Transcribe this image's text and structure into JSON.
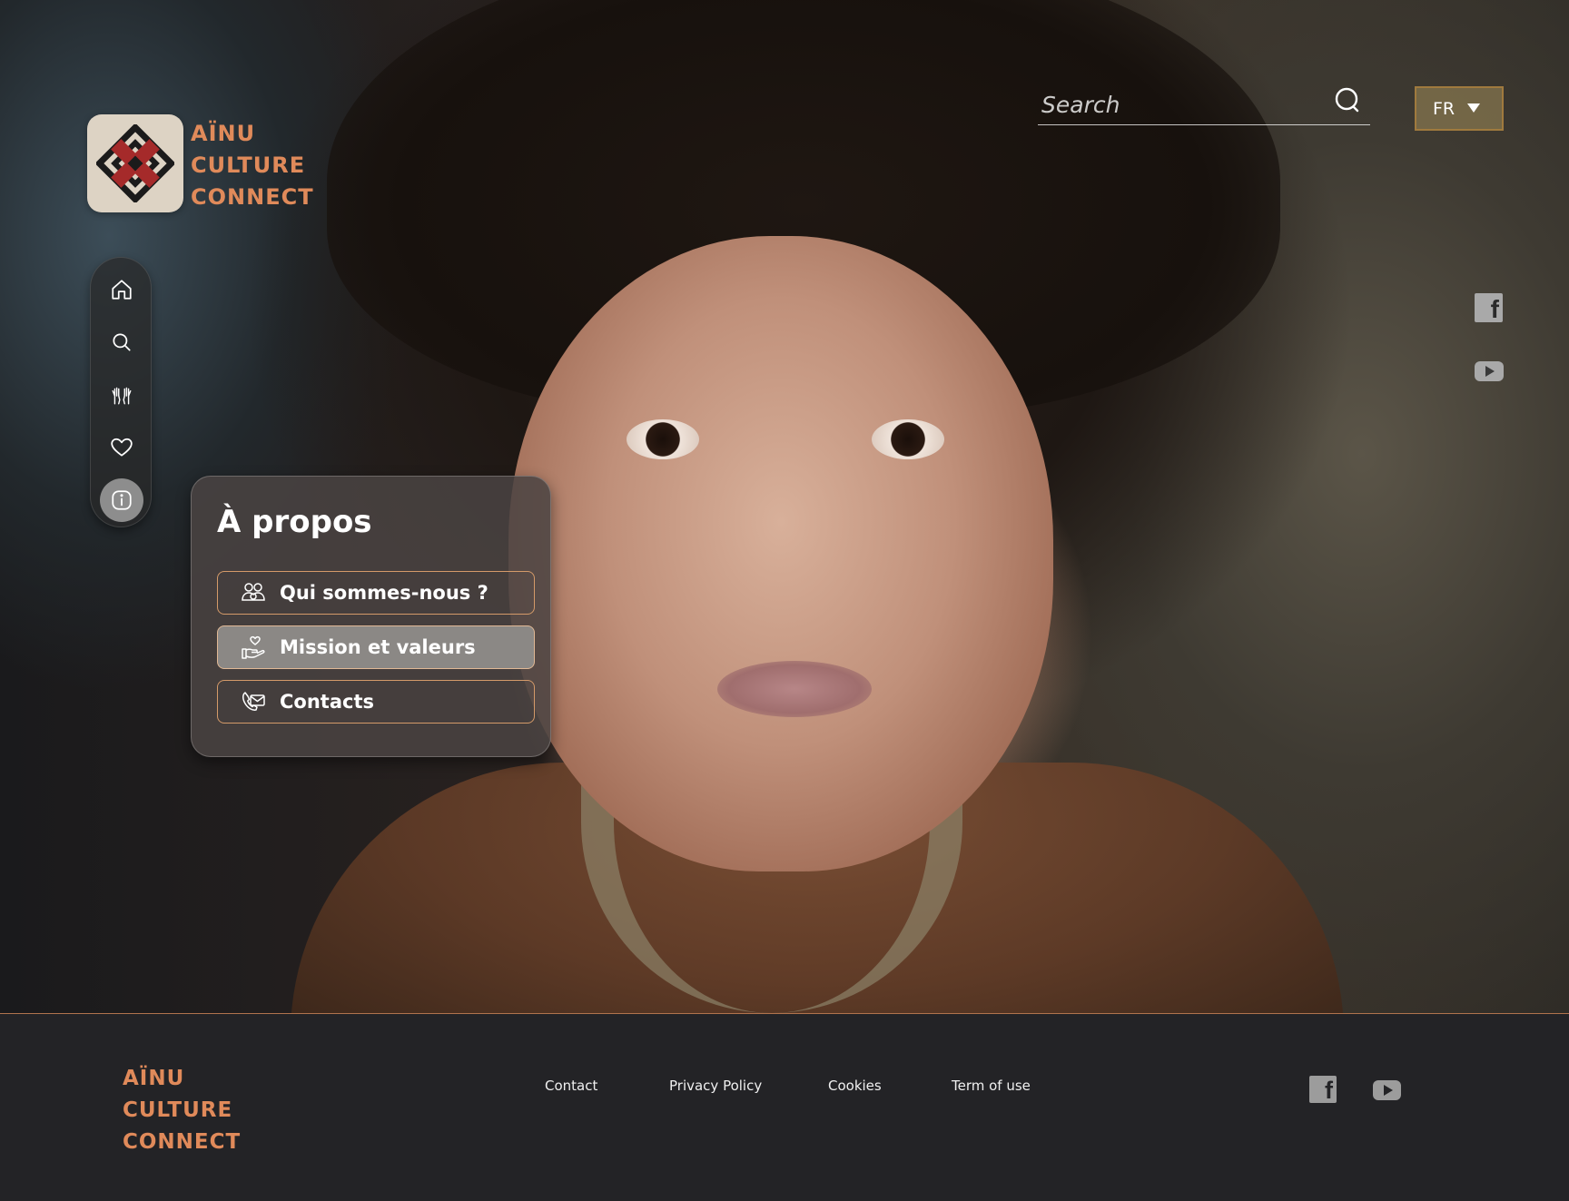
{
  "header": {
    "logo_lines": [
      "AÏNU",
      "CULTURE",
      "CONNECT"
    ],
    "search": {
      "placeholder": "Search"
    },
    "language": {
      "selected": "FR"
    }
  },
  "sidebar": {
    "items": [
      {
        "name": "home",
        "icon": "home-icon",
        "active": false
      },
      {
        "name": "search",
        "icon": "search-icon",
        "active": false
      },
      {
        "name": "community",
        "icon": "raised-hands-icon",
        "active": false
      },
      {
        "name": "favorites",
        "icon": "heart-icon",
        "active": false
      },
      {
        "name": "about",
        "icon": "info-icon",
        "active": true
      }
    ]
  },
  "social": {
    "facebook_icon": "facebook-icon",
    "youtube_icon": "youtube-icon"
  },
  "about_panel": {
    "title": "À propos",
    "items": [
      {
        "label": "Qui sommes-nous ?",
        "icon": "people-icon",
        "active": false
      },
      {
        "label": "Mission et valeurs",
        "icon": "hand-heart-icon",
        "active": true
      },
      {
        "label": "Contacts",
        "icon": "contact-envelope-icon",
        "active": false
      }
    ]
  },
  "footer": {
    "logo_lines": [
      "AÏNU",
      "CULTURE",
      "CONNECT"
    ],
    "links": [
      "Contact",
      "Privacy Policy",
      "Cookies",
      "Term of use"
    ]
  },
  "colors": {
    "accent": "#e08a5a",
    "panel_border": "#d49a69",
    "footer_bg": "#232326",
    "active_nav": "#8d8d8d"
  }
}
